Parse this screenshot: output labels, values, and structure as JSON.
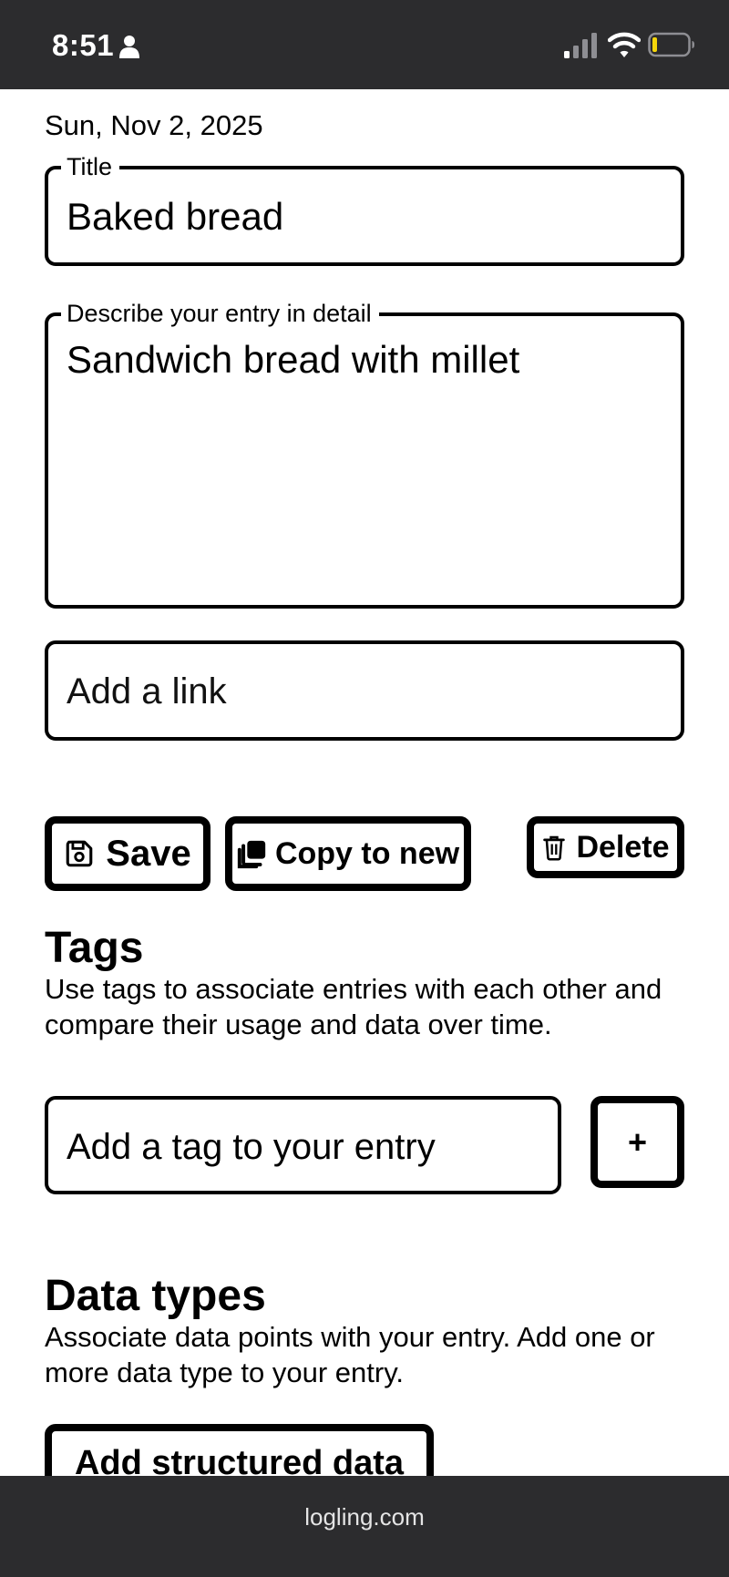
{
  "status_bar": {
    "time": "8:51",
    "icons": [
      "person-icon",
      "signal-icon",
      "wifi-icon",
      "battery-icon"
    ],
    "battery_color": "#f5d60a"
  },
  "entry": {
    "date": "Sun, Nov 2, 2025",
    "title_legend": "Title",
    "title_value": "Baked bread",
    "description_legend": "Describe your entry in detail",
    "description_value": "Sandwich bread with millet",
    "link_placeholder": "Add a link"
  },
  "actions": {
    "save_label": "Save",
    "copy_label": "Copy to new",
    "delete_label": "Delete",
    "icons": [
      "save-icon",
      "copy-icon",
      "trash-icon"
    ]
  },
  "tags": {
    "heading": "Tags",
    "description": "Use tags to associate entries with each other and compare their usage and data over time.",
    "input_placeholder": "Add a tag to your entry",
    "add_label": "+"
  },
  "data_types": {
    "heading": "Data types",
    "description": "Associate data points with your entry. Add one or more data type to your entry.",
    "add_label": "Add structured data"
  },
  "browser": {
    "url": "logling.com"
  }
}
